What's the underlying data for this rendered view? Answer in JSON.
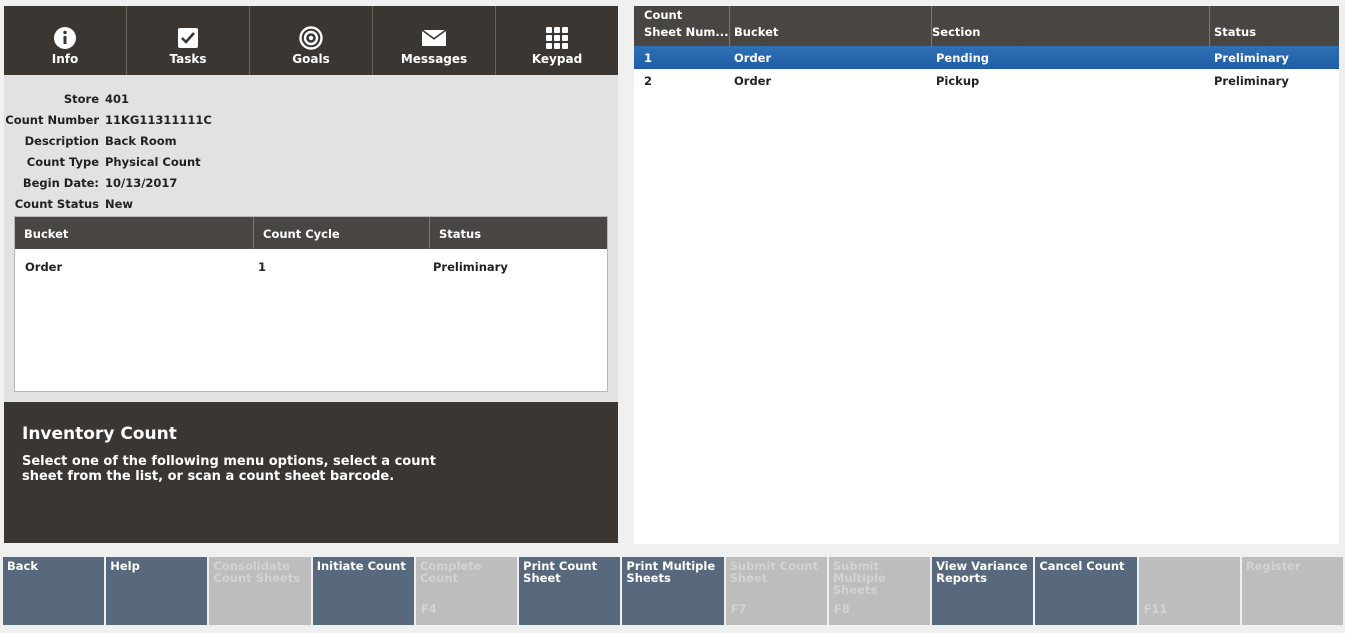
{
  "nav": [
    {
      "label": "Info",
      "icon": "info-icon"
    },
    {
      "label": "Tasks",
      "icon": "checkbox-icon"
    },
    {
      "label": "Goals",
      "icon": "target-icon"
    },
    {
      "label": "Messages",
      "icon": "envelope-icon"
    },
    {
      "label": "Keypad",
      "icon": "keypad-icon"
    }
  ],
  "info": {
    "store_label": "Store",
    "store": "401",
    "count_number_label": "Count Number",
    "count_number": "11KG11311111C",
    "description_label": "Description",
    "description": "Back Room",
    "count_type_label": "Count Type",
    "count_type": "Physical Count",
    "begin_date_label": "Begin Date:",
    "begin_date": "10/13/2017",
    "count_status_label": "Count Status",
    "count_status": "New"
  },
  "bucket_table": {
    "headers": [
      "Bucket",
      "Count Cycle",
      "Status"
    ],
    "rows": [
      [
        "Order",
        "1",
        "Preliminary"
      ]
    ]
  },
  "message": {
    "title": "Inventory Count",
    "text": "Select one of the following menu options, select a count sheet from the list, or scan a count sheet barcode."
  },
  "sheet_table": {
    "headers": [
      "Count Sheet Num...",
      "Bucket",
      "Section",
      "Status"
    ],
    "header_line1": "Count",
    "header_line2": "Sheet Num...",
    "rows": [
      [
        "1",
        "Order",
        "Pending",
        "Preliminary"
      ],
      [
        "2",
        "Order",
        "Pickup",
        "Preliminary"
      ]
    ]
  },
  "buttons": [
    {
      "label": "Back",
      "enabled": true,
      "key": ""
    },
    {
      "label": "Help",
      "enabled": true,
      "key": ""
    },
    {
      "label": "Consolidate Count Sheets",
      "enabled": false,
      "key": ""
    },
    {
      "label": "Initiate Count",
      "enabled": true,
      "key": ""
    },
    {
      "label": "Complete Count",
      "enabled": false,
      "key": "F4"
    },
    {
      "label": "Print Count Sheet",
      "enabled": true,
      "key": ""
    },
    {
      "label": "Print Multiple Sheets",
      "enabled": true,
      "key": ""
    },
    {
      "label": "Submit Count Sheet",
      "enabled": false,
      "key": "F7"
    },
    {
      "label": "Submit Multiple Sheets",
      "enabled": false,
      "key": "F8"
    },
    {
      "label": "View Variance Reports",
      "enabled": true,
      "key": ""
    },
    {
      "label": "Cancel Count",
      "enabled": true,
      "key": ""
    },
    {
      "label": "",
      "enabled": false,
      "key": "F11"
    },
    {
      "label": "Register",
      "enabled": false,
      "key": ""
    }
  ],
  "colors": {
    "dark_panel": "#3b3632",
    "header_bg": "#494543",
    "selected_row": "#2466ad",
    "button_enabled": "#58697d",
    "button_disabled": "#bdbdbd"
  }
}
